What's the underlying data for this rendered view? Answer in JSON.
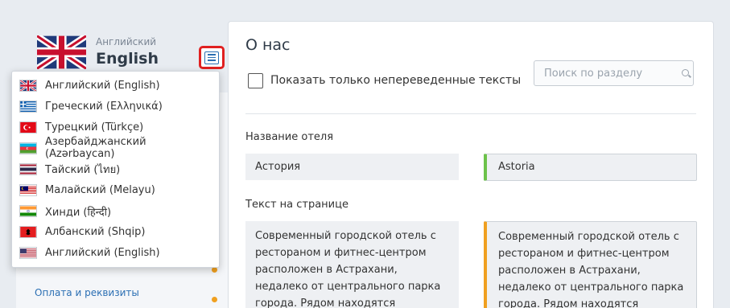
{
  "sidebar": {
    "current_lang_sub": "Английский",
    "current_lang_main": "English",
    "link": "Оплата и реквизиты"
  },
  "dropdown": {
    "items": [
      {
        "label": "Английский (English)",
        "flag": "uk-flag-icon"
      },
      {
        "label": "Греческий (Ελληνικά)",
        "flag": "greece-flag-icon"
      },
      {
        "label": "Турецкий (Türkçe)",
        "flag": "turkey-flag-icon"
      },
      {
        "label": "Азербайджанский (Azərbaycan)",
        "flag": "azerbaijan-flag-icon"
      },
      {
        "label": "Тайский (ไทย)",
        "flag": "thailand-flag-icon"
      },
      {
        "label": "Малайский (Melayu)",
        "flag": "malaysia-flag-icon"
      },
      {
        "label": "Хинди (हिन्दी)",
        "flag": "india-flag-icon"
      },
      {
        "label": "Албанский (Shqip)",
        "flag": "albania-flag-icon"
      },
      {
        "label": "Английский (English)",
        "flag": "usa-flag-icon"
      }
    ]
  },
  "main": {
    "title": "О нас",
    "checkbox_label": "Показать только непереведенные тексты",
    "search_placeholder": "Поиск по разделу",
    "field1": {
      "label": "Название отеля",
      "original": "Астория",
      "translation": "Astoria"
    },
    "field2": {
      "label": "Текст на странице",
      "original": "Современный городской отель с рестораном и фитнес-центром расположен в Астрахани, недалеко от центрального парка города. Рядом находятся ключевые",
      "translation": "Современный городской отель с рестораном и фитнес-центром расположен в Астрахани, недалеко от центрального парка города. Рядом находятся ключевые"
    }
  },
  "colors": {
    "accent": "#2b6fb3",
    "highlight_border": "#e02020",
    "translated": "#6cc24a",
    "pending": "#f0a020"
  }
}
